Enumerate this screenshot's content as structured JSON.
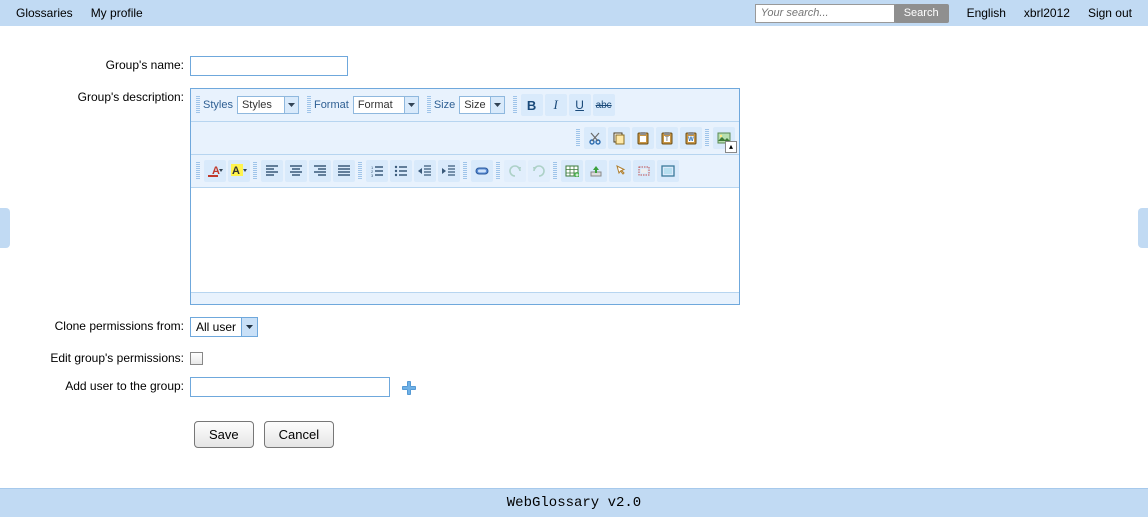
{
  "nav": {
    "glossaries": "Glossaries",
    "myprofile": "My profile",
    "english": "English",
    "user": "xbrl2012",
    "signout": "Sign out"
  },
  "search": {
    "placeholder": "Your search...",
    "button": "Search"
  },
  "form": {
    "labels": {
      "name": "Group's name:",
      "desc": "Group's description:",
      "clone": "Clone permissions from:",
      "edit": "Edit group's permissions:",
      "adduser": "Add user to the group:"
    },
    "clone_selected": "All user",
    "buttons": {
      "save": "Save",
      "cancel": "Cancel"
    }
  },
  "editor": {
    "row1": {
      "styles_label": "Styles",
      "styles_value": "Styles",
      "format_label": "Format",
      "format_value": "Format",
      "size_label": "Size",
      "size_value": "Size"
    }
  },
  "footer": "WebGlossary v2.0"
}
